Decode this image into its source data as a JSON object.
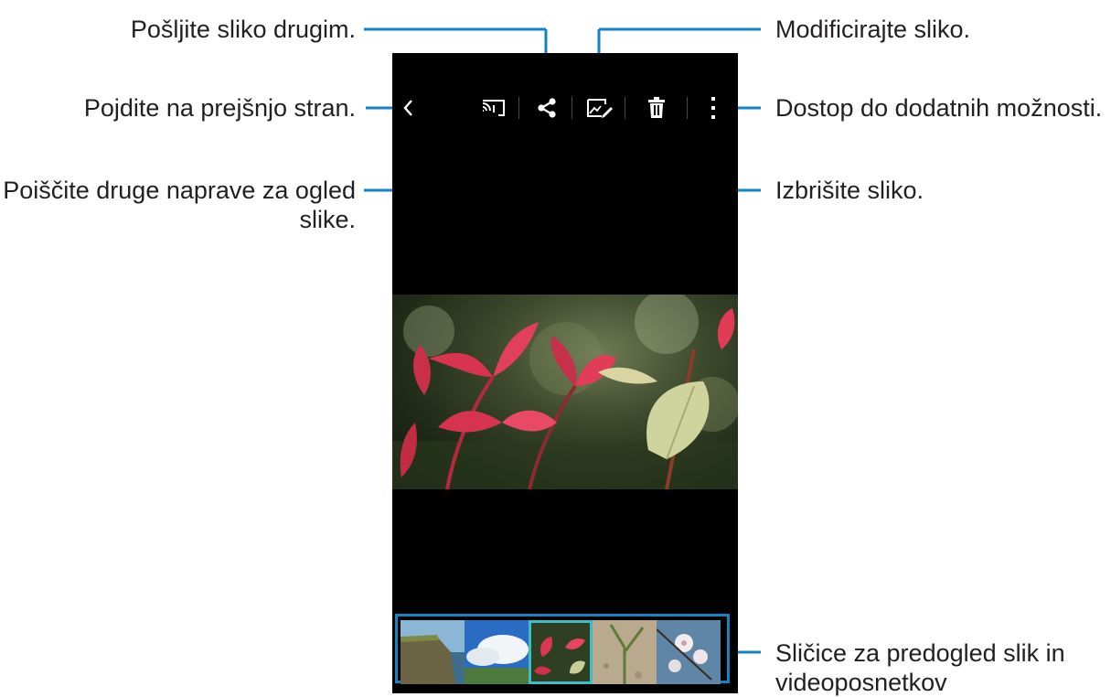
{
  "callouts": {
    "share": "Pošljite sliko drugim.",
    "back": "Pojdite na prejšnjo stran.",
    "nearby": "Poiščite druge naprave za ogled slike.",
    "edit": "Modificirajte sliko.",
    "more": "Dostop do dodatnih možnosti.",
    "delete": "Izbrišite sliko.",
    "thumbnails": "Sličice za predogled slik in videoposnetkov"
  },
  "colors": {
    "leader": "#1283c4",
    "selected_thumb": "#3fbcc4",
    "screen_bg": "#000000"
  },
  "icons": {
    "back": "chevron-left-icon",
    "nearby": "nearby-devices-icon",
    "share": "share-icon",
    "edit": "edit-picture-icon",
    "delete": "trash-icon",
    "more": "more-options-icon"
  },
  "filmstrip": {
    "thumbnails": [
      "coastal-cliff",
      "blue-sky-clouds",
      "red-leaves",
      "sprout-in-soil",
      "cherry-blossom"
    ],
    "selected": "red-leaves"
  }
}
